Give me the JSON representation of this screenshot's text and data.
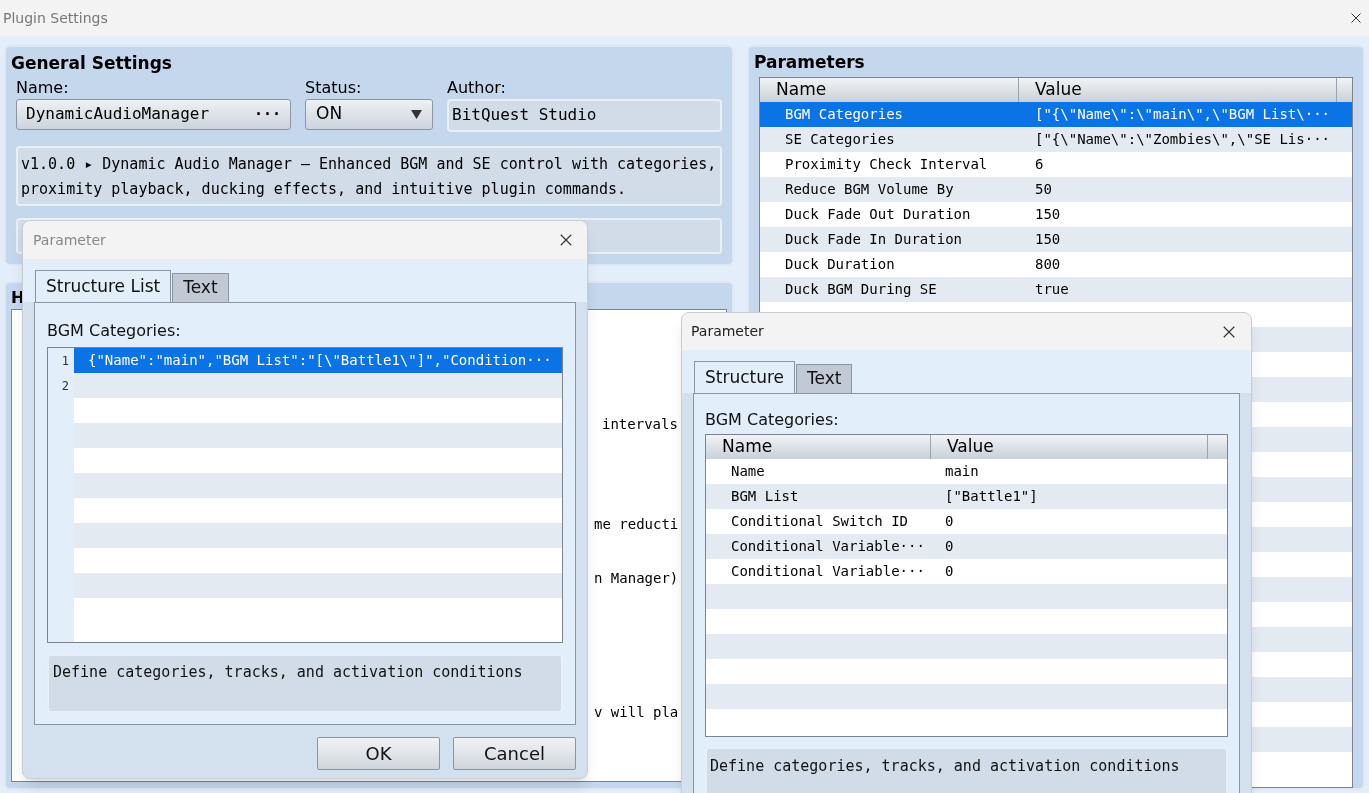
{
  "window": {
    "title": "Plugin Settings"
  },
  "general_settings": {
    "title": "General Settings",
    "name_label": "Name:",
    "name_value": "DynamicAudioManager",
    "name_button": "···",
    "status_label": "Status:",
    "status_value": "ON",
    "author_label": "Author:",
    "author_value": "BitQuest Studio",
    "description": "v1.0.0 ▸ Dynamic Audio Manager – Enhanced BGM and SE control with categories, proximity playback, ducking effects, and intuitive plugin commands."
  },
  "help": {
    "title": "H",
    "lines": [
      "intervals",
      "me reducti",
      "n Manager)",
      "v will pla"
    ]
  },
  "parameters": {
    "title": "Parameters",
    "columns": [
      "Name",
      "Value"
    ],
    "rows": [
      {
        "name": "BGM Categories",
        "value": "[\"{\\\"Name\\\":\\\"main\\\",\\\"BGM List\\···",
        "selected": true
      },
      {
        "name": "SE Categories",
        "value": "[\"{\\\"Name\\\":\\\"Zombies\\\",\\\"SE Lis···",
        "selected": false
      },
      {
        "name": "Proximity Check Interval",
        "value": "6",
        "selected": false
      },
      {
        "name": "Reduce BGM Volume By",
        "value": "50",
        "selected": false
      },
      {
        "name": "Duck Fade Out Duration",
        "value": "150",
        "selected": false
      },
      {
        "name": "Duck Fade In Duration",
        "value": "150",
        "selected": false
      },
      {
        "name": "Duck Duration",
        "value": "800",
        "selected": false
      },
      {
        "name": "Duck BGM During SE",
        "value": "true",
        "selected": false
      }
    ]
  },
  "dialogs": [
    {
      "kind": "list",
      "title": "Parameter",
      "tabs": [
        {
          "label": "Structure List",
          "selected": true
        },
        {
          "label": "Text",
          "selected": false
        }
      ],
      "label": "BGM Categories:",
      "lines": [
        {
          "number": "1",
          "text": "{\"Name\":\"main\",\"BGM List\":\"[\\\"Battle1\\\"]\",\"Condition···",
          "selected": true
        },
        {
          "number": "2",
          "selected": false
        }
      ],
      "description": "Define categories, tracks, and activation conditions",
      "buttons": [
        "OK",
        "Cancel"
      ]
    },
    {
      "kind": "table",
      "title": "Parameter",
      "tabs": [
        {
          "label": "Structure",
          "selected": true
        },
        {
          "label": "Text",
          "selected": false
        }
      ],
      "label": "BGM Categories:",
      "columns": [
        "Name",
        "Value"
      ],
      "rows": [
        {
          "name": "Name",
          "value": "main"
        },
        {
          "name": "BGM List",
          "value": "[\"Battle1\"]"
        },
        {
          "name": "Conditional Switch ID",
          "value": "0"
        },
        {
          "name": "Conditional Variable···",
          "value": "0"
        },
        {
          "name": "Conditional Variable···",
          "value": "0"
        }
      ],
      "description": "Define categories, tracks, and activation conditions"
    }
  ]
}
